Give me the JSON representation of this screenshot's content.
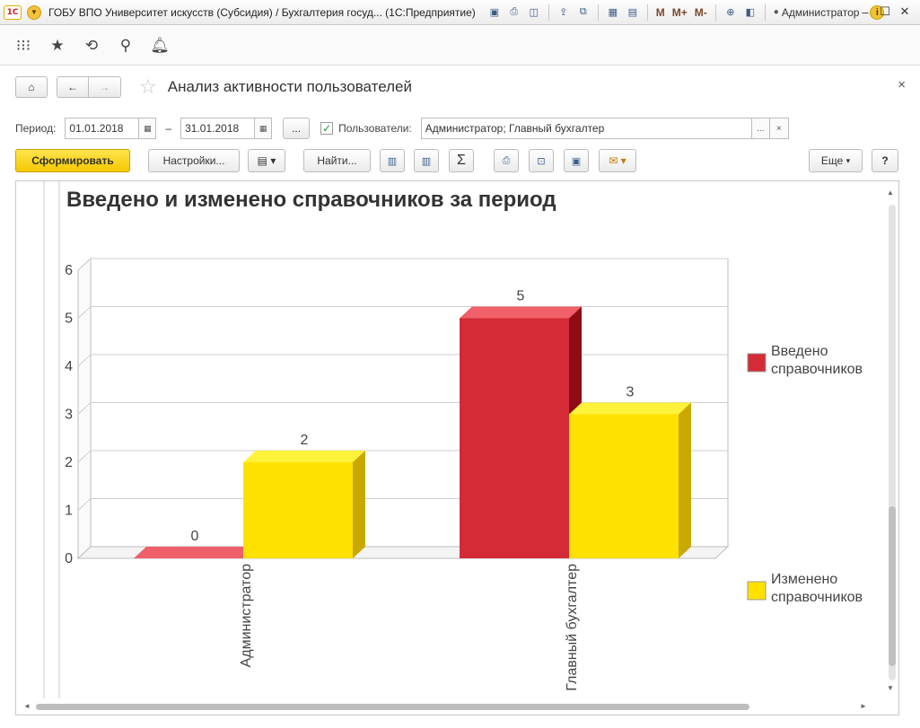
{
  "window": {
    "logo": "1С",
    "title": "ГОБУ ВПО Университет искусств (Субсидия) / Бухгалтерия госуд...  (1С:Предприятие)",
    "m_buttons": [
      "M",
      "M+",
      "M-"
    ],
    "user": "Администратор"
  },
  "form": {
    "title": "Анализ активности пользователей"
  },
  "filters": {
    "period_label": "Период:",
    "date_from": "01.01.2018",
    "dash": "–",
    "date_to": "31.01.2018",
    "dots": "...",
    "users_label": "Пользователи:",
    "users_checked": true,
    "users_value": "Администратор; Главный бухгалтер",
    "clear": "×"
  },
  "commands": {
    "generate": "Сформировать",
    "settings": "Настройки...",
    "find": "Найти...",
    "more": "Еще",
    "help": "?"
  },
  "colors": {
    "entered": "#d42b36",
    "changed": "#ffe100",
    "accent": "#f5c800"
  },
  "icons": {
    "window": [
      "save-icon",
      "print-icon",
      "preview-icon",
      "upload-icon",
      "copy-icon",
      "calculator-icon",
      "calendar-icon",
      "zoom-icon",
      "panel-icon"
    ],
    "navbar": [
      "apps-grid-icon",
      "favorites-star-icon",
      "history-icon",
      "search-icon",
      "bell-icon"
    ]
  },
  "chart_data": {
    "type": "bar",
    "title": "Введено и изменено справочников за период",
    "categories": [
      "Администратор",
      "Главный бухгалтер"
    ],
    "series": [
      {
        "name": "Введено справочников",
        "values": [
          0,
          5
        ]
      },
      {
        "name": "Изменено справочников",
        "values": [
          2,
          3
        ]
      }
    ],
    "ylim": [
      0,
      6
    ],
    "yticks": [
      "0",
      "1",
      "2",
      "3",
      "4",
      "5",
      "6"
    ],
    "grid": true,
    "legend": "right",
    "style": "3d"
  }
}
